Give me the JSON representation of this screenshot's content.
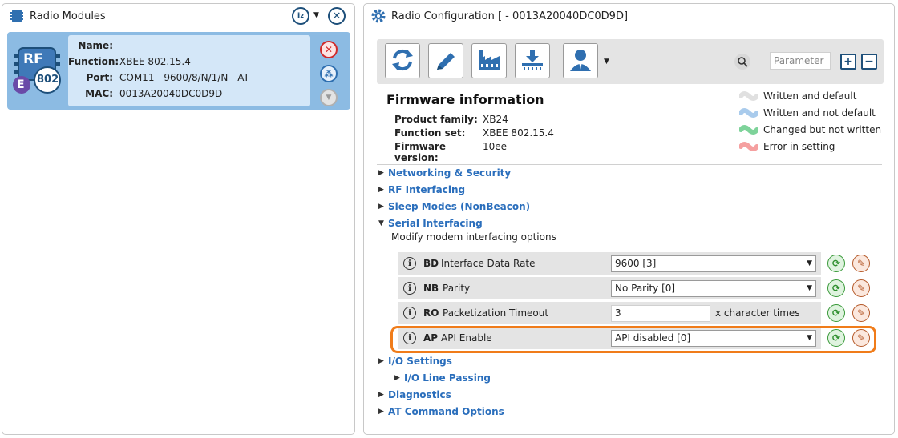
{
  "left_panel": {
    "title": "Radio Modules",
    "module": {
      "badge_top": "RF",
      "badge_letter": "E",
      "badge_protocol": "802",
      "labels": {
        "name": "Name:",
        "function": "Function:",
        "port": "Port:",
        "mac": "MAC:"
      },
      "name": "",
      "function": "XBEE 802.15.4",
      "port": "COM11 - 9600/8/N/1/N - AT",
      "mac": "0013A20040DC0D9D"
    }
  },
  "right_panel": {
    "title": "Radio Configuration [  - 0013A20040DC0D9D]",
    "search_placeholder": "Parameter",
    "firmware": {
      "title": "Firmware information",
      "rows": [
        {
          "label": "Product family:",
          "value": "XB24"
        },
        {
          "label": "Function set:",
          "value": "XBEE 802.15.4"
        },
        {
          "label": "Firmware version:",
          "value": "10ee"
        }
      ]
    },
    "legend": [
      {
        "label": "Written and default",
        "color": "#e0e0e0"
      },
      {
        "label": "Written and not default",
        "color": "#a9cbec"
      },
      {
        "label": "Changed but not written",
        "color": "#7ed39a"
      },
      {
        "label": "Error in setting",
        "color": "#f5a0a0"
      }
    ],
    "sections": [
      {
        "label": "Networking & Security",
        "expanded": false
      },
      {
        "label": "RF Interfacing",
        "expanded": false
      },
      {
        "label": "Sleep Modes (NonBeacon)",
        "expanded": false
      },
      {
        "label": "Serial Interfacing",
        "expanded": true,
        "description": "Modify modem interfacing options"
      },
      {
        "label": "I/O Settings",
        "expanded": false
      },
      {
        "label": "I/O Line Passing",
        "expanded": false
      },
      {
        "label": "Diagnostics",
        "expanded": false
      },
      {
        "label": "AT Command Options",
        "expanded": false
      }
    ],
    "params": [
      {
        "code": "BD",
        "name": "Interface Data Rate",
        "type": "select",
        "value": "9600 [3]"
      },
      {
        "code": "NB",
        "name": "Parity",
        "type": "select",
        "value": "No Parity [0]"
      },
      {
        "code": "RO",
        "name": "Packetization Timeout",
        "type": "input",
        "value": "3",
        "suffix": "x character times"
      },
      {
        "code": "AP",
        "name": "API Enable",
        "type": "select",
        "value": "API disabled [0]"
      }
    ],
    "highlight_color": "#f07c1a"
  }
}
